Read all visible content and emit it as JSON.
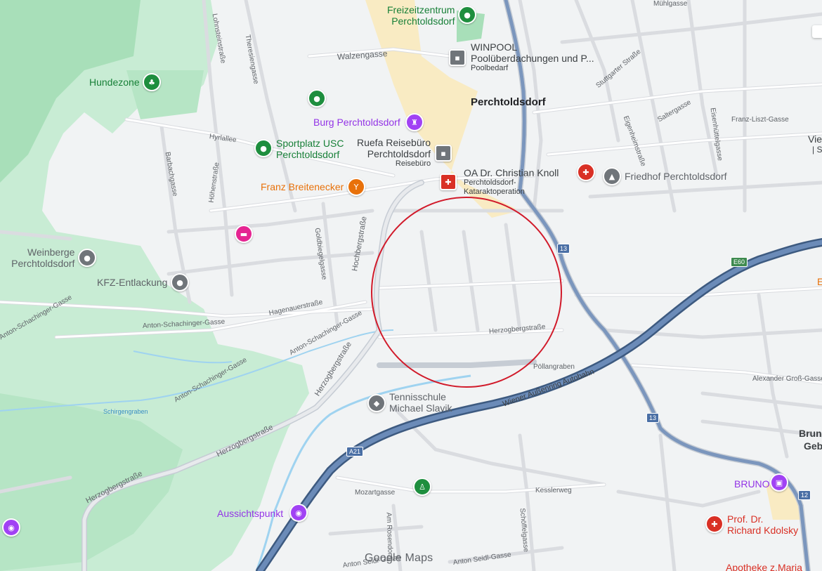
{
  "map": {
    "watermark": "Google Maps",
    "town_label": "Perchtoldsdorf",
    "colors": {
      "background": "#f1f3f4",
      "park": "#c8ecd4",
      "forest": "#a8dfb9",
      "road": "#ffffff",
      "road_outline": "#dadce0",
      "highway": "#5b7aa6",
      "highway_outline": "#3d5a80",
      "water": "#9fd3f0",
      "circle": "#d11a2a",
      "old_town": "#fbe9b7"
    },
    "pois": [
      {
        "name": "Freizeitzentrum",
        "name2": "Perchtoldsdorf",
        "icon": "park-icon",
        "color": "#1e8e3e"
      },
      {
        "name": "WINPOOL",
        "name2": "Poolüberdachungen und P...",
        "sub": "Poolbedarf",
        "icon": "store-icon",
        "color": "#5f6368"
      },
      {
        "name": "Hundezone",
        "icon": "tree-icon",
        "color": "#1e8e3e"
      },
      {
        "name": "Burg Perchtoldsdorf",
        "icon": "castle-icon",
        "color": "#a142f4"
      },
      {
        "name": "Sportplatz USC",
        "name2": "Perchtoldsdorf",
        "icon": "sports-icon",
        "color": "#1e8e3e"
      },
      {
        "name": "Ruefa Reisebüro",
        "name2": "Perchtoldsdorf",
        "sub": "Reisebüro",
        "icon": "store-icon",
        "color": "#5f6368"
      },
      {
        "name": "OA Dr. Christian Knoll",
        "sub": "Perchtoldsdorf-",
        "sub2": "Kataraktoperation",
        "icon": "medical-icon",
        "color": "#d93025"
      },
      {
        "name": "Friedhof Perchtoldsdorf",
        "icon": "cemetery-icon",
        "color": "#5f6368"
      },
      {
        "name": "Franz Breitenecker",
        "icon": "wine-icon",
        "color": "#e8710a"
      },
      {
        "name": "Weinberge",
        "name2": "Perchtoldsdorf",
        "icon": "pin-icon",
        "color": "#5f6368"
      },
      {
        "name": "KFZ-Entlackung",
        "icon": "pin-icon",
        "color": "#5f6368"
      },
      {
        "name": "Tennisschule",
        "name2": "Michael Slavik",
        "icon": "school-icon",
        "color": "#5f6368"
      },
      {
        "name": "Aussichtspunkt",
        "icon": "camera-icon",
        "color": "#a142f4"
      },
      {
        "name": "BRUNO",
        "icon": "museum-icon",
        "color": "#a142f4"
      },
      {
        "name": "Prof. Dr.",
        "name2": "Richard Kdolsky",
        "icon": "medical-icon",
        "color": "#d93025"
      },
      {
        "name": "Apotheke z.Maria",
        "icon": "pharmacy-icon",
        "color": "#d93025"
      }
    ],
    "streets": [
      "Walzengasse",
      "Lohnsteinstraße",
      "Theresiengasse",
      "Hyrlallee",
      "Barbachgasse",
      "Höhenstraße",
      "Goldbiegelgasse",
      "Hochbergstraße",
      "Hagenauerstraße",
      "Anton-Schachinger-Gasse",
      "Anton-Schachinger-Gasse",
      "Anton-Schachinger-Gasse",
      "Anton-Schachinger-Gasse",
      "Herzogbergstraße",
      "Herzogbergstraße",
      "Herzogbergstraße",
      "Herzogbergstraße",
      "Schirgengraben",
      "Pöllangraben",
      "Wiener Außenring Autobahn",
      "Alexander Groß-Gasse",
      "Franz-Liszt-Gasse",
      "Eigenheimstraße",
      "Saltergasse",
      "Eisenhüttelgasse",
      "Stuttgarter Straße",
      "Mühlgasse",
      "Mozartgasse",
      "Kesslerweg",
      "Schöffelgasse",
      "Am Rosendorn",
      "Anton Seidl-Gasse",
      "Anton Seidl-Gasse"
    ],
    "shields": [
      "13",
      "13",
      "E60",
      "A21",
      "12"
    ],
    "edge_labels": [
      "Vie",
      "| S",
      "E",
      "Brun",
      "Geb"
    ]
  }
}
